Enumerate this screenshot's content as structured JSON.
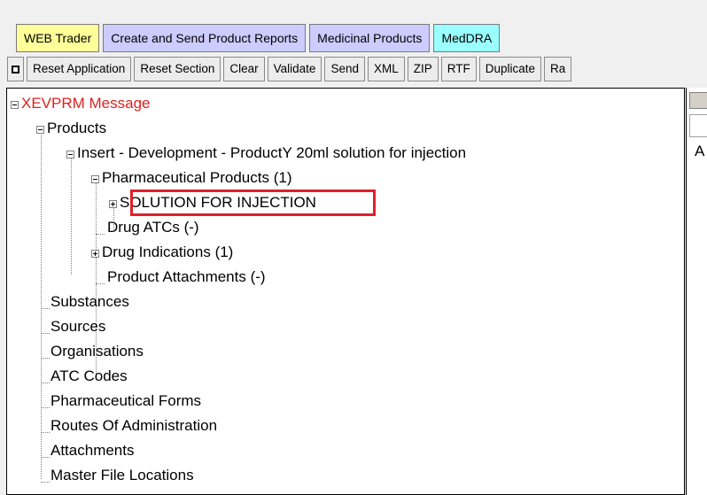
{
  "tabs": [
    {
      "label": "WEB Trader",
      "color": "#ffff99"
    },
    {
      "label": "Create and Send Product Reports",
      "color": "#ccccff"
    },
    {
      "label": "Medicinal Products",
      "color": "#ccccff"
    },
    {
      "label": "MedDRA",
      "color": "#99ffff"
    }
  ],
  "toolbar": {
    "buttons": [
      "Reset Application",
      "Reset Section",
      "Clear",
      "Validate",
      "Send",
      "XML",
      "ZIP",
      "RTF",
      "Duplicate",
      "Ra"
    ]
  },
  "tree": {
    "root": "XEVPRM Message",
    "products": "Products",
    "insert": "Insert - Development - ProductY 20ml solution for injection",
    "pharmaceutical_products": "Pharmaceutical Products (1)",
    "solution": "SOLUTION FOR INJECTION",
    "drug_atcs": "Drug ATCs (-)",
    "drug_indications": "Drug Indications (1)",
    "product_attachments": "Product Attachments (-)",
    "substances": "Substances",
    "sources": "Sources",
    "organisations": "Organisations",
    "atc_codes": "ATC Codes",
    "pharmaceutical_forms": "Pharmaceutical Forms",
    "routes": "Routes Of Administration",
    "attachments": "Attachments",
    "master_file_locations": "Master File Locations"
  },
  "right_panel": {
    "letter": "A"
  },
  "colors": {
    "highlight": "#e0202a",
    "root_text": "#e02020"
  }
}
